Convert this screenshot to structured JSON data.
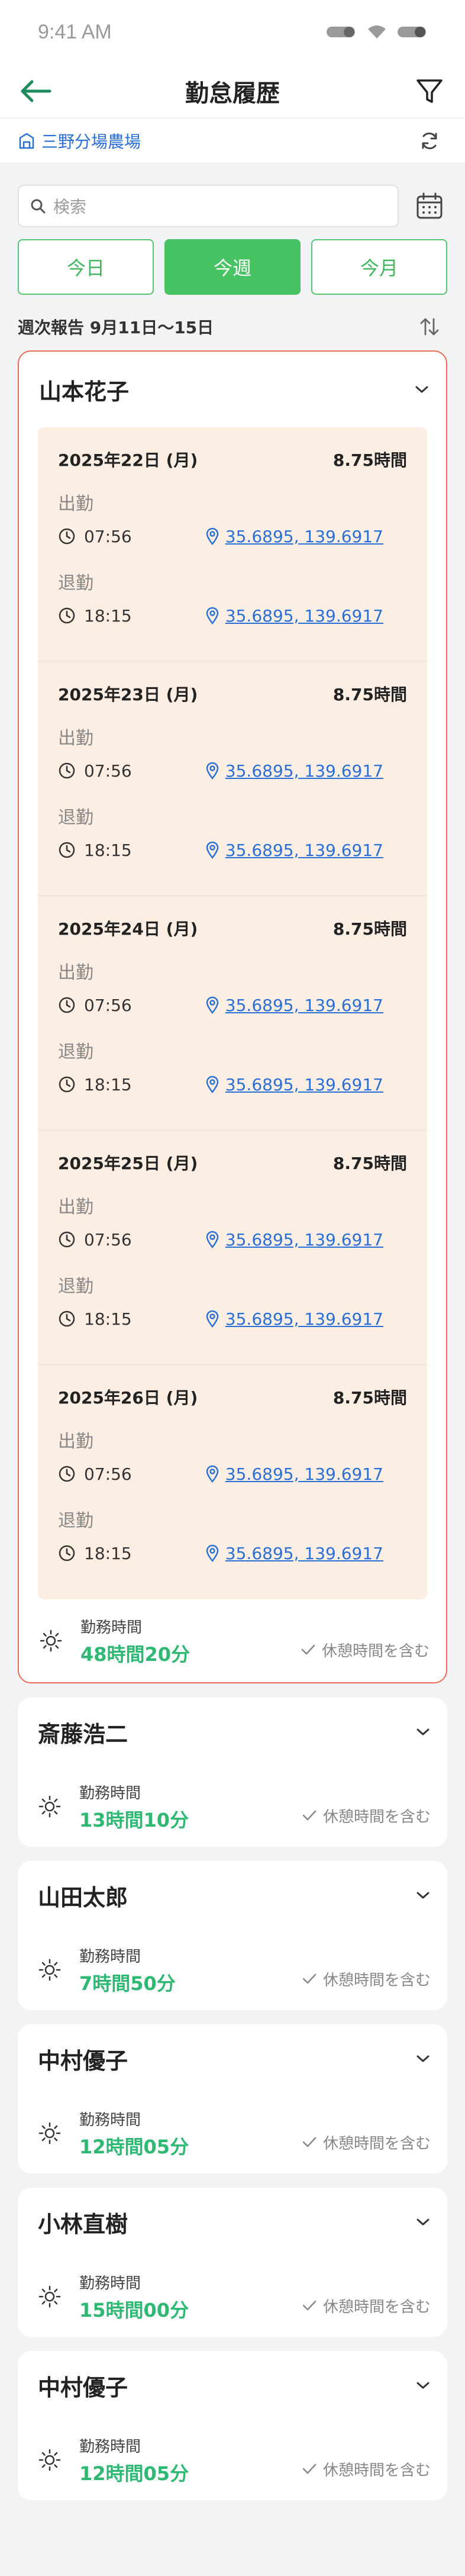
{
  "status_bar": {
    "time": "9:41 AM"
  },
  "header": {
    "title": "勤怠履歴",
    "back_icon": "arrow-left-icon",
    "filter_icon": "filter-icon"
  },
  "farm": {
    "name": "三野分場農場",
    "icon": "building-icon",
    "switch_icon": "refresh-icon"
  },
  "search": {
    "placeholder": "検索",
    "calendar_icon": "calendar-icon"
  },
  "period_tabs": [
    {
      "label": "今日",
      "active": false
    },
    {
      "label": "今週",
      "active": true
    },
    {
      "label": "今月",
      "active": false
    }
  ],
  "report": {
    "label": "週次報告 9月11日〜15日",
    "sort_icon": "sort-icon"
  },
  "colors": {
    "accent_green": "#47c363",
    "value_green": "#2fb873",
    "link_blue": "#2a6fd6",
    "highlight_border": "#ec6c55",
    "day_bg": "#fdeee4"
  },
  "employees": [
    {
      "name": "山本花子",
      "expanded": true,
      "days": [
        {
          "date": "2025年22日 (月)",
          "hours": "8.75時間",
          "in_label": "出勤",
          "in_time": "07:56",
          "in_loc": "35.6895, 139.6917",
          "out_label": "退勤",
          "out_time": "18:15",
          "out_loc": "35.6895, 139.6917"
        },
        {
          "date": "2025年23日 (月)",
          "hours": "8.75時間",
          "in_label": "出勤",
          "in_time": "07:56",
          "in_loc": "35.6895, 139.6917",
          "out_label": "退勤",
          "out_time": "18:15",
          "out_loc": "35.6895, 139.6917"
        },
        {
          "date": "2025年24日 (月)",
          "hours": "8.75時間",
          "in_label": "出勤",
          "in_time": "07:56",
          "in_loc": "35.6895, 139.6917",
          "out_label": "退勤",
          "out_time": "18:15",
          "out_loc": "35.6895, 139.6917"
        },
        {
          "date": "2025年25日 (月)",
          "hours": "8.75時間",
          "in_label": "出勤",
          "in_time": "07:56",
          "in_loc": "35.6895, 139.6917",
          "out_label": "退勤",
          "out_time": "18:15",
          "out_loc": "35.6895, 139.6917"
        },
        {
          "date": "2025年26日 (月)",
          "hours": "8.75時間",
          "in_label": "出勤",
          "in_time": "07:56",
          "in_loc": "35.6895, 139.6917",
          "out_label": "退勤",
          "out_time": "18:15",
          "out_loc": "35.6895, 139.6917"
        }
      ],
      "summary_label": "勤務時間",
      "total": "48時間20分",
      "note": "休憩時間を含む"
    },
    {
      "name": "斎藤浩二",
      "expanded": false,
      "summary_label": "勤務時間",
      "total": "13時間10分",
      "note": "休憩時間を含む"
    },
    {
      "name": "山田太郎",
      "expanded": false,
      "summary_label": "勤務時間",
      "total": "7時間50分",
      "note": "休憩時間を含む"
    },
    {
      "name": "中村優子",
      "expanded": false,
      "summary_label": "勤務時間",
      "total": "12時間05分",
      "note": "休憩時間を含む"
    },
    {
      "name": "小林直樹",
      "expanded": false,
      "summary_label": "勤務時間",
      "total": "15時間00分",
      "note": "休憩時間を含む"
    },
    {
      "name": "中村優子",
      "expanded": false,
      "summary_label": "勤務時間",
      "total": "12時間05分",
      "note": "休憩時間を含む"
    }
  ]
}
